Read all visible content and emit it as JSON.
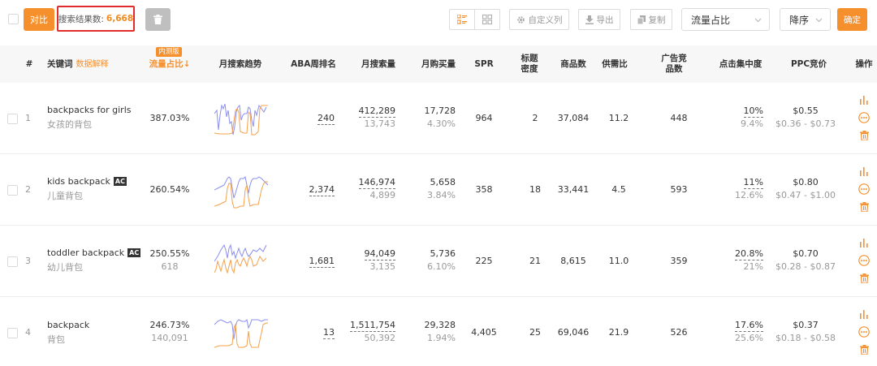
{
  "toolbar": {
    "compare_label": "对比",
    "result_label": "搜索结果数:",
    "result_count": "6,668",
    "custom_cols_label": "自定义列",
    "export_label": "导出",
    "copy_label": "复制",
    "sort_field_value": "流量占比",
    "sort_order_value": "降序",
    "confirm_label": "确定"
  },
  "colors": {
    "accent": "#f5902d",
    "highlight_border": "#e02c2c",
    "trend_blue": "#8b8ff0",
    "trend_orange": "#f5a04a"
  },
  "header": {
    "index": "#",
    "keyword": "关键词",
    "keyword_sub": "数据解释",
    "traffic_badge": "内测版",
    "traffic_share": "流量占比↓",
    "trend": "月搜索趋势",
    "aba_rank": "ABA周排名",
    "monthly_search": "月搜索量",
    "monthly_purchase": "月购买量",
    "spr": "SPR",
    "title_density": "标题密度",
    "product_count": "商品数",
    "supply_demand": "供需比",
    "ad_products": "广告竞品数",
    "click_concentration": "点击集中度",
    "ppc": "PPC竞价",
    "actions": "操作"
  },
  "rows": [
    {
      "index": "1",
      "keyword_en": "backpacks for girls",
      "ac": "",
      "keyword_cn": "女孩的背包",
      "traffic_share": "387.03%",
      "traffic_share_sub": "",
      "aba_rank": "240",
      "monthly_search": "412,289",
      "monthly_search_sub": "13,743",
      "monthly_purchase": "17,728",
      "purchase_rate": "4.30%",
      "spr": "964",
      "title_density": "2",
      "product_count": "37,084",
      "supply_demand": "11.2",
      "ad_products": "448",
      "click_top": "10%",
      "click_sub": "9.4%",
      "ppc": "$0.55",
      "ppc_range": "$0.36 - $0.73"
    },
    {
      "index": "2",
      "keyword_en": "kids backpack",
      "ac": "AC",
      "keyword_cn": "儿童背包",
      "traffic_share": "260.54%",
      "traffic_share_sub": "",
      "aba_rank": "2,374",
      "monthly_search": "146,974",
      "monthly_search_sub": "4,899",
      "monthly_purchase": "5,658",
      "purchase_rate": "3.84%",
      "spr": "358",
      "title_density": "18",
      "product_count": "33,441",
      "supply_demand": "4.5",
      "ad_products": "593",
      "click_top": "11%",
      "click_sub": "12.6%",
      "ppc": "$0.80",
      "ppc_range": "$0.47 - $1.00"
    },
    {
      "index": "3",
      "keyword_en": "toddler backpack",
      "ac": "AC",
      "keyword_cn": "幼儿背包",
      "traffic_share": "250.55%",
      "traffic_share_sub": "618",
      "aba_rank": "1,681",
      "monthly_search": "94,049",
      "monthly_search_sub": "3,135",
      "monthly_purchase": "5,736",
      "purchase_rate": "6.10%",
      "spr": "225",
      "title_density": "21",
      "product_count": "8,615",
      "supply_demand": "11.0",
      "ad_products": "359",
      "click_top": "20.8%",
      "click_sub": "21%",
      "ppc": "$0.70",
      "ppc_range": "$0.28 - $0.87"
    },
    {
      "index": "4",
      "keyword_en": "backpack",
      "ac": "",
      "keyword_cn": "背包",
      "traffic_share": "246.73%",
      "traffic_share_sub": "140,091",
      "aba_rank": "13",
      "monthly_search": "1,511,754",
      "monthly_search_sub": "50,392",
      "monthly_purchase": "29,328",
      "purchase_rate": "1.94%",
      "spr": "4,405",
      "title_density": "25",
      "product_count": "69,046",
      "supply_demand": "21.9",
      "ad_products": "526",
      "click_top": "17.6%",
      "click_sub": "25.6%",
      "ppc": "$0.37",
      "ppc_range": "$0.18 - $0.58"
    }
  ]
}
